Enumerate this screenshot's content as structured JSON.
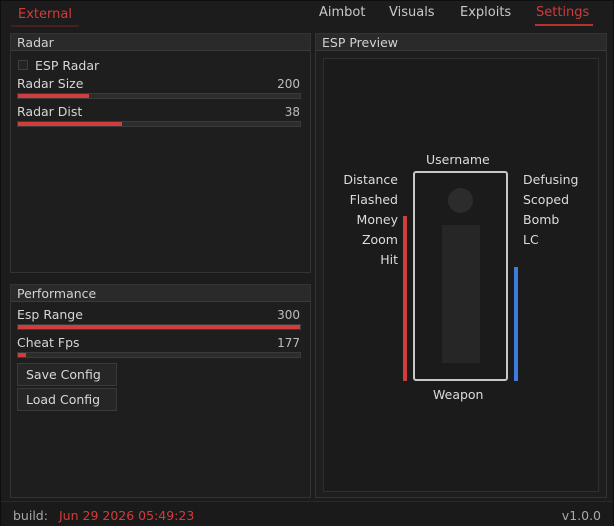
{
  "header": {
    "app_title": "External",
    "tabs": [
      {
        "label": "Aimbot"
      },
      {
        "label": "Visuals"
      },
      {
        "label": "Exploits"
      },
      {
        "label": "Settings"
      }
    ],
    "active_tab": "Settings"
  },
  "radar": {
    "title": "Radar",
    "esp_radar": {
      "label": "ESP Radar",
      "checked": false
    },
    "radar_size": {
      "label": "Radar Size",
      "value": "200",
      "fraction": 0.25
    },
    "radar_dist": {
      "label": "Radar Dist",
      "value": "38",
      "fraction": 0.37
    }
  },
  "performance": {
    "title": "Performance",
    "esp_range": {
      "label": "Esp Range",
      "value": "300",
      "fraction": 1.0
    },
    "cheat_fps": {
      "label": "Cheat Fps",
      "value": "177",
      "fraction": 0.03
    },
    "save_config": "Save Config",
    "load_config": "Load Config"
  },
  "esp_preview": {
    "title": "ESP Preview",
    "top_label": "Username",
    "bottom_label": "Weapon",
    "left_labels": [
      "Distance",
      "Flashed",
      "Money",
      "Zoom",
      "Hit"
    ],
    "right_labels": [
      "Defusing",
      "Scoped",
      "Bomb",
      "LC"
    ],
    "health_bar_color": "#d13d3d",
    "armor_bar_color": "#3e7be0"
  },
  "footer": {
    "build_label": "build:",
    "build_date": "Jun 29 2026 05:49:23",
    "version": "v1.0.0"
  },
  "colors": {
    "accent": "#d23b3b",
    "background": "#1c1c1c"
  }
}
